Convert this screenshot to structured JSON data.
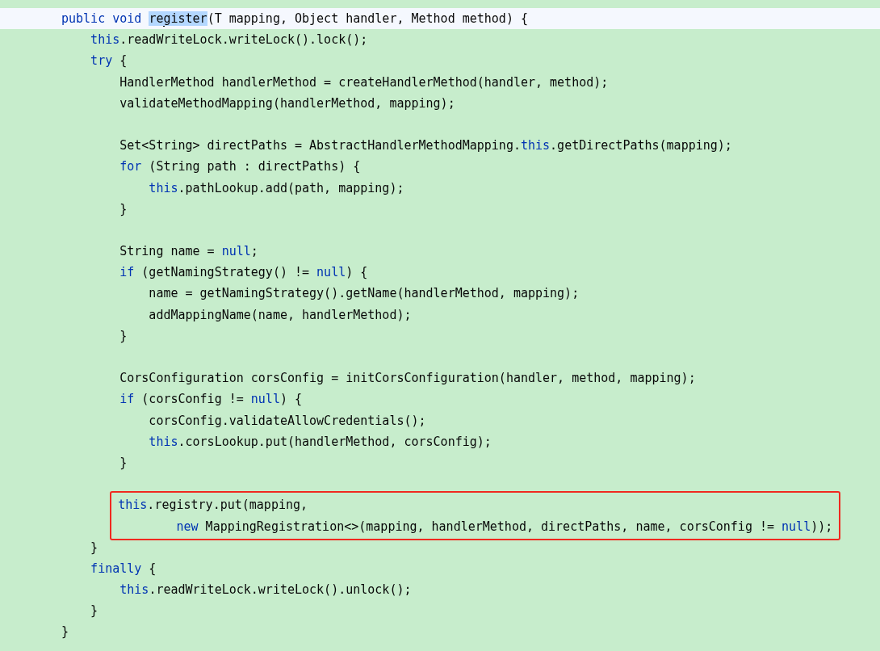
{
  "code": [
    {
      "kind": "line",
      "current": true,
      "tokens": [
        {
          "kind": "kw",
          "text": "public void "
        },
        {
          "kind": "sel",
          "text": "re"
        },
        {
          "kind": "caret"
        },
        {
          "kind": "sel",
          "text": "gister"
        },
        {
          "kind": "tx",
          "text": "(T mapping, Object handler, Method method) {"
        }
      ]
    },
    {
      "kind": "line",
      "current": false,
      "tokens": [
        {
          "kind": "kw",
          "text": "    this"
        },
        {
          "kind": "tx",
          "text": ".readWriteLock.writeLock().lock();"
        }
      ]
    },
    {
      "kind": "line",
      "current": false,
      "tokens": [
        {
          "kind": "kw",
          "text": "    try"
        },
        {
          "kind": "tx",
          "text": " {"
        }
      ]
    },
    {
      "kind": "line",
      "current": false,
      "tokens": [
        {
          "kind": "tx",
          "text": "        HandlerMethod handlerMethod = createHandlerMethod(handler, method);"
        }
      ]
    },
    {
      "kind": "line",
      "current": false,
      "tokens": [
        {
          "kind": "tx",
          "text": "        validateMethodMapping(handlerMethod, mapping);"
        }
      ]
    },
    {
      "kind": "blank"
    },
    {
      "kind": "line",
      "current": false,
      "tokens": [
        {
          "kind": "tx",
          "text": "        Set<String> directPaths = AbstractHandlerMethodMapping."
        },
        {
          "kind": "kw",
          "text": "this"
        },
        {
          "kind": "tx",
          "text": ".getDirectPaths(mapping);"
        }
      ]
    },
    {
      "kind": "line",
      "current": false,
      "tokens": [
        {
          "kind": "kw",
          "text": "        for"
        },
        {
          "kind": "tx",
          "text": " (String path : directPaths) {"
        }
      ]
    },
    {
      "kind": "line",
      "current": false,
      "tokens": [
        {
          "kind": "kw",
          "text": "            this"
        },
        {
          "kind": "tx",
          "text": ".pathLookup.add(path, mapping);"
        }
      ]
    },
    {
      "kind": "line",
      "current": false,
      "tokens": [
        {
          "kind": "tx",
          "text": "        }"
        }
      ]
    },
    {
      "kind": "blank"
    },
    {
      "kind": "line",
      "current": false,
      "tokens": [
        {
          "kind": "tx",
          "text": "        String name = "
        },
        {
          "kind": "kw",
          "text": "null"
        },
        {
          "kind": "tx",
          "text": ";"
        }
      ]
    },
    {
      "kind": "line",
      "current": false,
      "tokens": [
        {
          "kind": "kw",
          "text": "        if"
        },
        {
          "kind": "tx",
          "text": " (getNamingStrategy() != "
        },
        {
          "kind": "kw",
          "text": "null"
        },
        {
          "kind": "tx",
          "text": ") {"
        }
      ]
    },
    {
      "kind": "line",
      "current": false,
      "tokens": [
        {
          "kind": "tx",
          "text": "            name = getNamingStrategy().getName(handlerMethod, mapping);"
        }
      ]
    },
    {
      "kind": "line",
      "current": false,
      "tokens": [
        {
          "kind": "tx",
          "text": "            addMappingName(name, handlerMethod);"
        }
      ]
    },
    {
      "kind": "line",
      "current": false,
      "tokens": [
        {
          "kind": "tx",
          "text": "        }"
        }
      ]
    },
    {
      "kind": "blank"
    },
    {
      "kind": "line",
      "current": false,
      "tokens": [
        {
          "kind": "tx",
          "text": "        CorsConfiguration corsConfig = initCorsConfiguration(handler, method, mapping);"
        }
      ]
    },
    {
      "kind": "line",
      "current": false,
      "tokens": [
        {
          "kind": "kw",
          "text": "        if"
        },
        {
          "kind": "tx",
          "text": " (corsConfig != "
        },
        {
          "kind": "kw",
          "text": "null"
        },
        {
          "kind": "tx",
          "text": ") {"
        }
      ]
    },
    {
      "kind": "line",
      "current": false,
      "tokens": [
        {
          "kind": "tx",
          "text": "            corsConfig.validateAllowCredentials();"
        }
      ]
    },
    {
      "kind": "line",
      "current": false,
      "tokens": [
        {
          "kind": "kw",
          "text": "            this"
        },
        {
          "kind": "tx",
          "text": ".corsLookup.put(handlerMethod, corsConfig);"
        }
      ]
    },
    {
      "kind": "line",
      "current": false,
      "tokens": [
        {
          "kind": "tx",
          "text": "        }"
        }
      ]
    },
    {
      "kind": "blank"
    },
    {
      "kind": "box",
      "lines": [
        {
          "kind": "line",
          "current": false,
          "tokens": [
            {
              "kind": "kw",
              "text": "this"
            },
            {
              "kind": "tx",
              "text": ".registry.put(mapping,"
            }
          ]
        },
        {
          "kind": "line",
          "current": false,
          "tokens": [
            {
              "kind": "kw",
              "text": "        new"
            },
            {
              "kind": "tx",
              "text": " MappingRegistration<>(mapping, handlerMethod, directPaths, name, corsConfig != "
            },
            {
              "kind": "kw",
              "text": "null"
            },
            {
              "kind": "tx",
              "text": "));"
            }
          ]
        }
      ]
    },
    {
      "kind": "line",
      "current": false,
      "tokens": [
        {
          "kind": "tx",
          "text": "    }"
        }
      ]
    },
    {
      "kind": "line",
      "current": false,
      "tokens": [
        {
          "kind": "kw",
          "text": "    finally"
        },
        {
          "kind": "tx",
          "text": " {"
        }
      ]
    },
    {
      "kind": "line",
      "current": false,
      "tokens": [
        {
          "kind": "kw",
          "text": "        this"
        },
        {
          "kind": "tx",
          "text": ".readWriteLock.writeLock().unlock();"
        }
      ]
    },
    {
      "kind": "line",
      "current": false,
      "tokens": [
        {
          "kind": "tx",
          "text": "    }"
        }
      ]
    },
    {
      "kind": "line",
      "current": false,
      "tokens": [
        {
          "kind": "tx",
          "text": "}"
        }
      ]
    }
  ]
}
